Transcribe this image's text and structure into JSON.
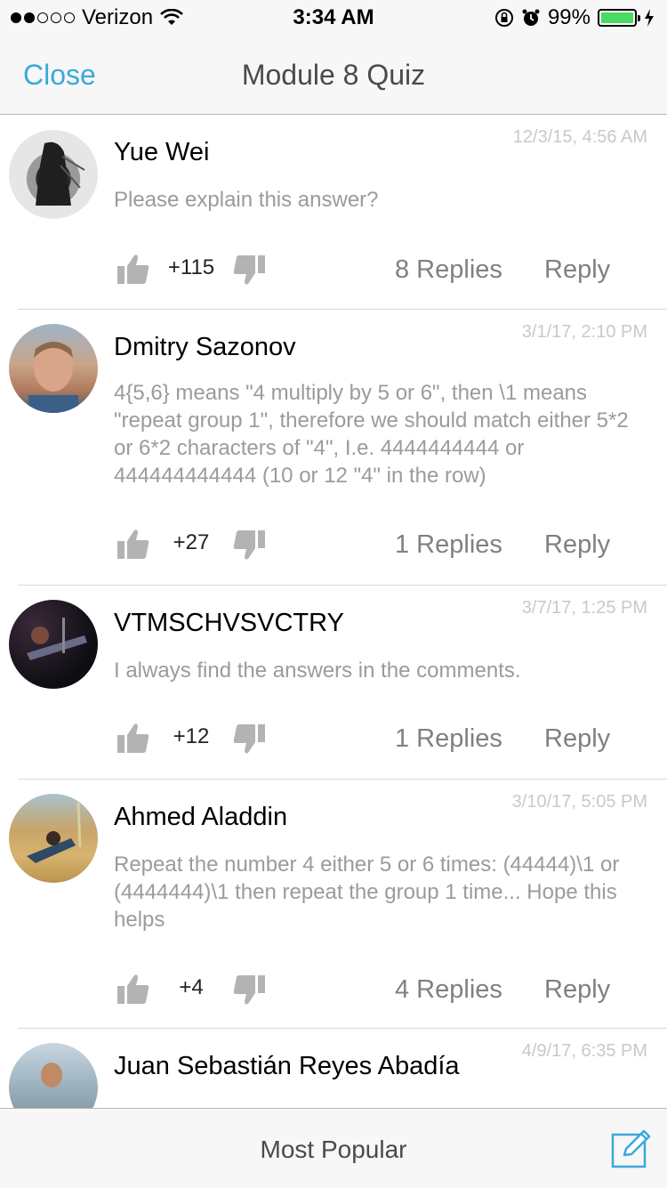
{
  "status_bar": {
    "carrier": "Verizon",
    "time": "3:34 AM",
    "battery": "99%",
    "battery_level": 0.99
  },
  "nav": {
    "close_label": "Close",
    "title": "Module 8 Quiz"
  },
  "comments": [
    {
      "author": "Yue Wei",
      "date": "12/3/15, 4:56 AM",
      "body": "Please explain this answer?",
      "score": "+115",
      "replies": "8 Replies",
      "reply_label": "Reply"
    },
    {
      "author": "Dmitry Sazonov",
      "date": "3/1/17, 2:10 PM",
      "body": "4{5,6} means \"4 multiply by 5 or 6\", then \\1 means \"repeat group 1\", therefore we should match either 5*2 or 6*2 characters of \"4\", I.e. 4444444444 or 444444444444 (10 or 12 \"4\" in the row)",
      "score": "+27",
      "replies": "1 Replies",
      "reply_label": "Reply"
    },
    {
      "author": "VTMSCHVSVCTRY",
      "date": "3/7/17, 1:25 PM",
      "body": "I always find the answers in the comments.",
      "score": "+12",
      "replies": "1 Replies",
      "reply_label": "Reply"
    },
    {
      "author": "Ahmed Aladdin",
      "date": "3/10/17, 5:05 PM",
      "body": "Repeat the number 4 either 5 or 6 times: (44444)\\1 or (4444444)\\1 then repeat the group 1 time... Hope this helps",
      "score": "+4",
      "replies": "4 Replies",
      "reply_label": "Reply"
    },
    {
      "author": "Juan Sebastián Reyes Abadía",
      "date": "4/9/17, 6:35 PM"
    }
  ],
  "bottom": {
    "sort_label": "Most Popular"
  },
  "icons": {
    "like": "thumbs-up-icon",
    "dislike": "thumbs-down-icon",
    "compose": "compose-icon"
  },
  "colors": {
    "accent": "#3aa9d8",
    "icon_gray": "#b3b3b3",
    "battery": "#4cd964"
  }
}
